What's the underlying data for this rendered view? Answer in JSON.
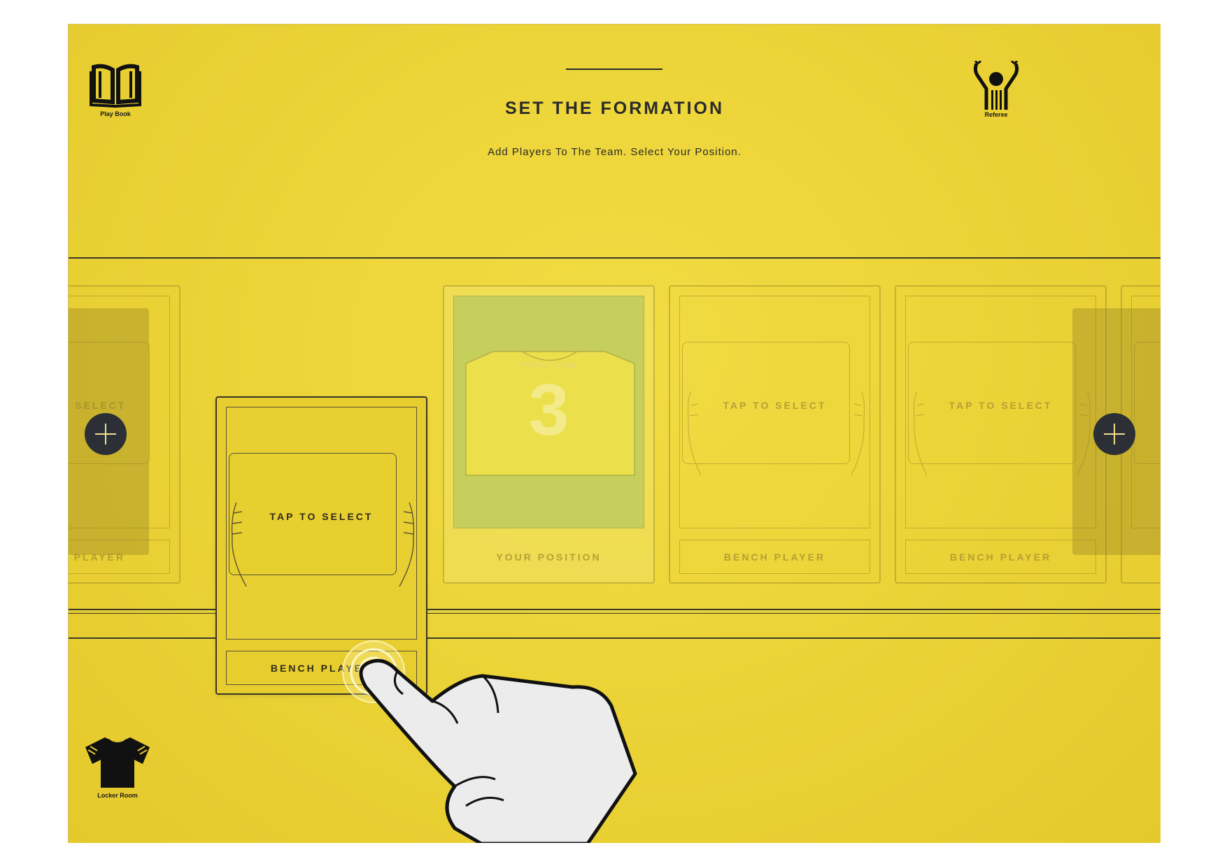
{
  "header": {
    "title": "SET THE FORMATION",
    "subtitle": "Add Players To The Team. Select Your Position."
  },
  "nav": {
    "play_book": {
      "label": "Play Book",
      "icon": "book-icon"
    },
    "referee": {
      "label": "Referee",
      "icon": "referee-icon"
    },
    "locker_room": {
      "label": "Locker Room",
      "icon": "jersey-icon"
    }
  },
  "cards": [
    {
      "tap": "TAP TO SELECT",
      "footer": "BENCH PLAYER",
      "state": "partial-left"
    },
    {
      "tap": "TAP TO SELECT",
      "footer": "BENCH PLAYER",
      "state": "lifted"
    },
    {
      "position_word": "POSITION",
      "position_number": "3",
      "footer": "YOUR POSITION",
      "state": "your-position"
    },
    {
      "tap": "TAP TO SELECT",
      "footer": "BENCH PLAYER",
      "state": "empty"
    },
    {
      "tap": "TAP TO SELECT",
      "footer": "BENCH PLAYER",
      "state": "empty"
    }
  ],
  "colors": {
    "background": "#ecd438",
    "ink": "#2a2a2a",
    "position_fill": "#c7cf5c",
    "add_button": "#2c2f36"
  }
}
